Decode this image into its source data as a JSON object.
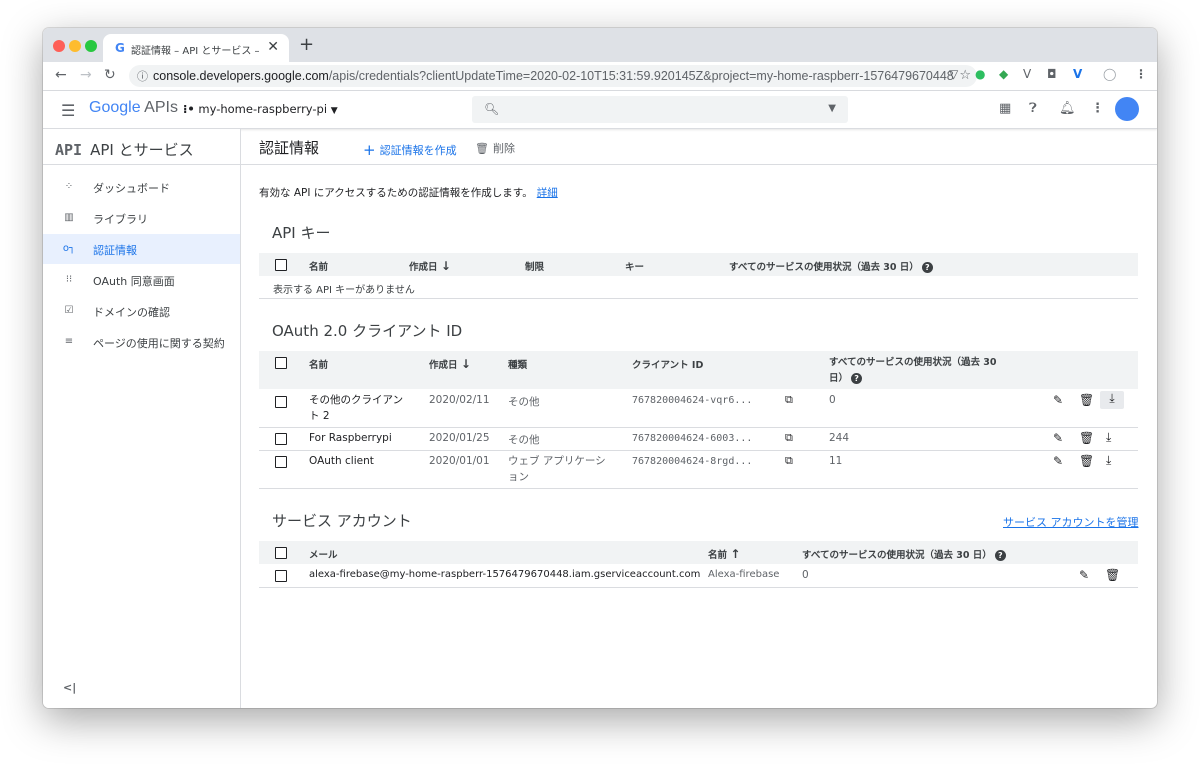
{
  "browser": {
    "tab_favicon": "G",
    "tab_title": "認証情報 – API とサービス – my-h",
    "tab_close": "✕",
    "new_tab": "+",
    "url_host": "console.developers.google.com",
    "url_path": "/apis/credentials?clientUpdateTime=2020-02-10T15:31:59.920145Z&project=my-home-raspberr-1576479670448"
  },
  "header": {
    "logo_google": "Google",
    "logo_apis": "APIs",
    "project": "my-home-raspberry-pi"
  },
  "sidebar": {
    "title_api": "API",
    "title": "API とサービス",
    "items": [
      {
        "label": "ダッシュボード",
        "icon": "dashboard-icon",
        "glyph": "⁘"
      },
      {
        "label": "ライブラリ",
        "icon": "library-icon",
        "glyph": "▥"
      },
      {
        "label": "認証情報",
        "icon": "key-icon",
        "glyph": "o┐"
      },
      {
        "label": "OAuth 同意画面",
        "icon": "consent-icon",
        "glyph": "⁝⁝"
      },
      {
        "label": "ドメインの確認",
        "icon": "domain-icon",
        "glyph": "☑"
      },
      {
        "label": "ページの使用に関する契約",
        "icon": "settings-list-icon",
        "glyph": "≡"
      }
    ],
    "collapse": "<|"
  },
  "toolbar": {
    "title": "認証情報",
    "create_label": "認証情報を作成",
    "delete_label": "削除"
  },
  "intro": {
    "text": "有効な API にアクセスするための認証情報を作成します。",
    "link": "詳細"
  },
  "api_keys": {
    "title": "API キー",
    "headers": {
      "name": "名前",
      "created": "作成日",
      "restriction": "制限",
      "key": "キー",
      "usage": "すべてのサービスの使用状況（過去 30 日）"
    },
    "empty": "表示する API キーがありません"
  },
  "oauth": {
    "title": "OAuth 2.0 クライアント ID",
    "headers": {
      "name": "名前",
      "created": "作成日",
      "type": "種類",
      "client_id": "クライアント ID",
      "usage": "すべてのサービスの使用状況（過去 30 日）"
    },
    "rows": [
      {
        "name": "その他のクライアント 2",
        "created": "2020/02/11",
        "type": "その他",
        "client_id": "767820004624-vqr6...",
        "usage": "0"
      },
      {
        "name": "For Raspberrypi",
        "created": "2020/01/25",
        "type": "その他",
        "client_id": "767820004624-6003...",
        "usage": "244"
      },
      {
        "name": "OAuth client",
        "created": "2020/01/01",
        "type": "ウェブ アプリケーション",
        "client_id": "767820004624-8rgd...",
        "usage": "11"
      }
    ]
  },
  "service_accounts": {
    "title": "サービス アカウント",
    "manage_link": "サービス アカウントを管理",
    "headers": {
      "email": "メール",
      "name": "名前",
      "usage": "すべてのサービスの使用状況（過去 30 日）"
    },
    "rows": [
      {
        "email": "alexa-firebase@my-home-raspberr-1576479670448.iam.gserviceaccount.com",
        "name": "Alexa-firebase",
        "usage": "0"
      }
    ]
  },
  "colors": {
    "accent": "#1a73e8",
    "header_bg": "#f1f3f4",
    "active_bg": "#e8f0fe"
  }
}
